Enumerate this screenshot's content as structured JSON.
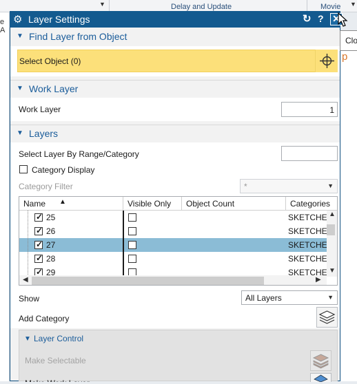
{
  "background": {
    "ribbon_center_label": "Delay and Update",
    "ribbon_right_label": "Movie",
    "left_truncated_text": "e A",
    "right_truncated_text": "p"
  },
  "dialog": {
    "title": "Layer Settings",
    "tooltip": "Clo",
    "find_layer": {
      "header": "Find Layer from Object",
      "select_object_label": "Select Object (0)"
    },
    "work_layer": {
      "header": "Work Layer",
      "label": "Work Layer",
      "value": "1"
    },
    "layers": {
      "header": "Layers",
      "range_label": "Select Layer By Range/Category",
      "range_value": "",
      "category_display_label": "Category Display",
      "category_filter_label": "Category Filter",
      "category_filter_value": "*",
      "columns": [
        "Name",
        "Visible Only",
        "Object Count",
        "Categories"
      ],
      "rows": [
        {
          "name": "25",
          "checked": true,
          "selected": false,
          "category": "SKETCHES"
        },
        {
          "name": "26",
          "checked": true,
          "selected": false,
          "category": "SKETCHES"
        },
        {
          "name": "27",
          "checked": true,
          "selected": true,
          "category": "SKETCHES"
        },
        {
          "name": "28",
          "checked": true,
          "selected": false,
          "category": "SKETCHES"
        },
        {
          "name": "29",
          "checked": true,
          "selected": false,
          "category": "SKETCHES"
        }
      ],
      "show_label": "Show",
      "show_value": "All Layers",
      "add_category_label": "Add Category"
    },
    "layer_control": {
      "header": "Layer Control",
      "make_selectable_label": "Make Selectable",
      "next_label_partial": "Make Work Layer"
    }
  }
}
